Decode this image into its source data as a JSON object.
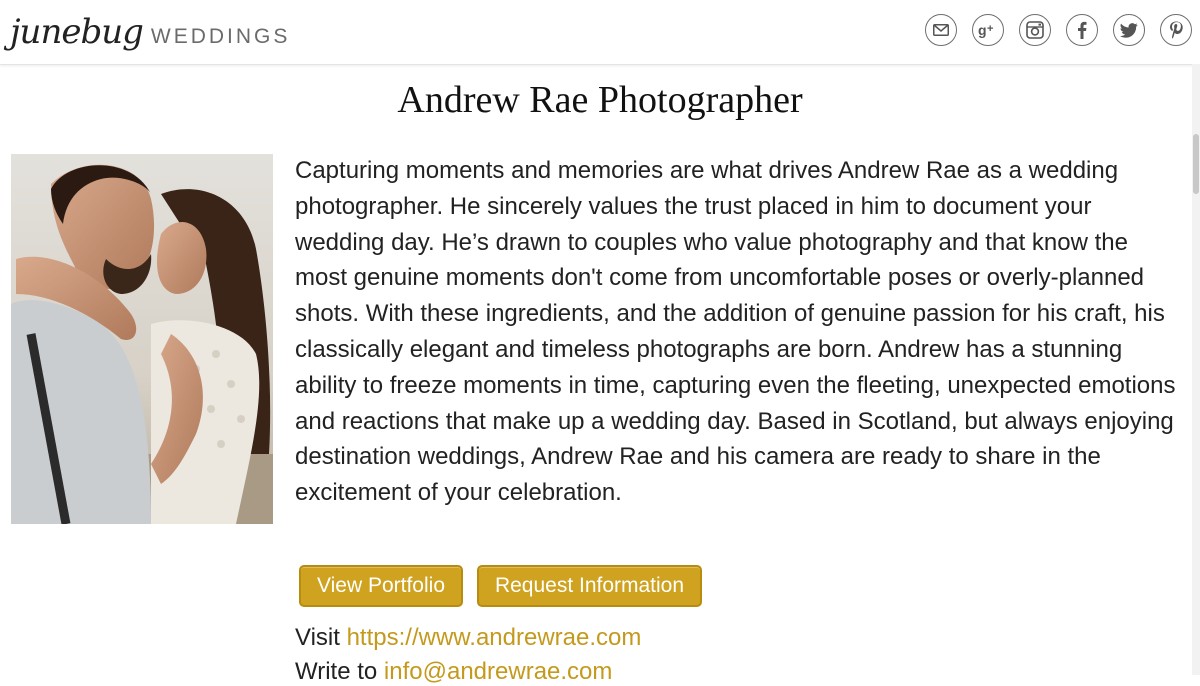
{
  "header": {
    "logo_script": "junebug",
    "logo_word": "WEDDINGS",
    "social_icons": [
      "mail-icon",
      "google-plus-icon",
      "instagram-icon",
      "facebook-icon",
      "twitter-icon",
      "pinterest-icon"
    ]
  },
  "main": {
    "title": "Andrew Rae Photographer",
    "description": "Capturing moments and memories are what drives Andrew Rae as a wedding photographer. He sincerely values the trust placed in him to document your wedding day. He’s drawn to couples who value photography and that know the most genuine moments don't come from uncomfortable poses or overly-planned shots. With these ingredients, and the addition of genuine passion for his craft, his classically elegant and timeless photographs are born. Andrew has a stunning ability to freeze moments in time, capturing even the fleeting, unexpected emotions and reactions that make up a wedding day. Based in Scotland, but always enjoying destination weddings, Andrew Rae and his camera are ready to share in the excitement of your celebration.",
    "buttons": {
      "portfolio": "View Portfolio",
      "request": "Request Information"
    },
    "contact": {
      "visit_label": "Visit",
      "visit_url": "https://www.andrewrae.com",
      "write_label": "Write to",
      "write_email": "info@andrewrae.com"
    }
  },
  "colors": {
    "accent": "#cfa21f",
    "link": "#c49a1d",
    "text": "#222222"
  }
}
